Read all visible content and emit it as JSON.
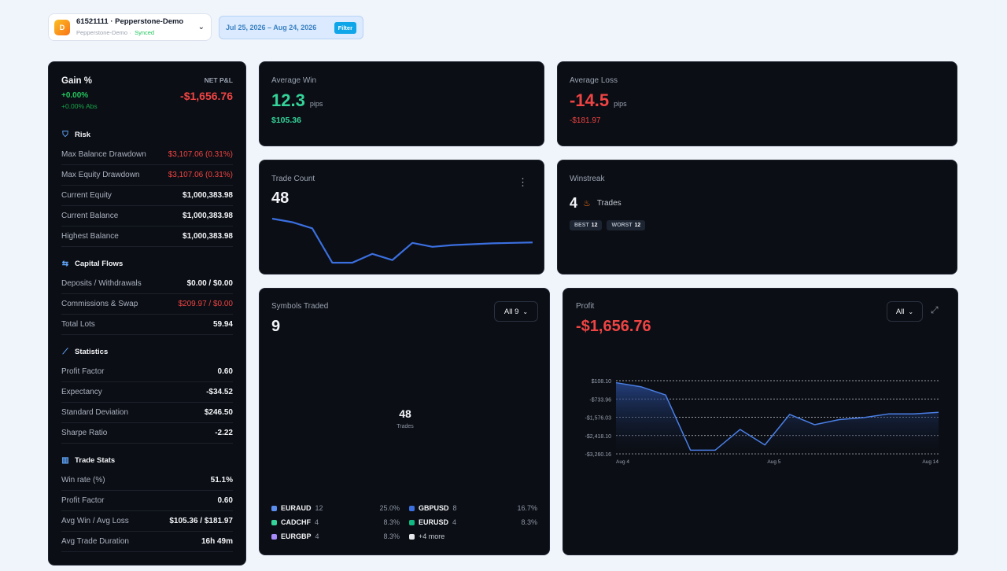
{
  "account": {
    "logo_letter": "D",
    "title": "61521111 · Pepperstone-Demo",
    "subtitle": "Pepperstone-Demo ·",
    "status": "Synced"
  },
  "daterange": {
    "text": "Jul 25, 2026 – Aug 24, 2026",
    "filter_label": "Filter"
  },
  "summary": {
    "gain_label": "Gain %",
    "gain_value": "+0.00%",
    "gain_abs": "+0.00% Abs",
    "netpnl_label": "NET P&L",
    "netpnl_value": "-$1,656.76"
  },
  "sections": {
    "risk": "Risk",
    "capital": "Capital Flows",
    "statistics": "Statistics",
    "tradestats": "Trade Stats"
  },
  "risk_rows": [
    {
      "k": "Max Balance Drawdown",
      "v": "$3,107.06 (0.31%)"
    },
    {
      "k": "Max Equity Drawdown",
      "v": "$3,107.06 (0.31%)"
    },
    {
      "k": "Current Equity",
      "v": "$1,000,383.98"
    },
    {
      "k": "Current Balance",
      "v": "$1,000,383.98"
    },
    {
      "k": "Highest Balance",
      "v": "$1,000,383.98"
    }
  ],
  "capital_rows": [
    {
      "k": "Deposits / Withdrawals",
      "v": "$0.00 / $0.00"
    },
    {
      "k": "Commissions & Swap",
      "v": "$209.97 / $0.00"
    },
    {
      "k": "Total Lots",
      "v": "59.94"
    }
  ],
  "stats_rows": [
    {
      "k": "Profit Factor",
      "v": "0.60"
    },
    {
      "k": "Expectancy",
      "v": "-$34.52"
    },
    {
      "k": "Standard Deviation",
      "v": "$246.50"
    },
    {
      "k": "Sharpe Ratio",
      "v": "-2.22"
    }
  ],
  "trade_rows": [
    {
      "k": "Win rate (%)",
      "v": "51.1%"
    },
    {
      "k": "Profit Factor",
      "v": "0.60"
    },
    {
      "k": "Avg Win / Avg Loss",
      "v": "$105.36 / $181.97"
    },
    {
      "k": "Avg Trade Duration",
      "v": "16h 49m"
    }
  ],
  "avg_win": {
    "label": "Average Win",
    "value": "12.3",
    "unit": "pips",
    "amount": "$105.36"
  },
  "avg_loss": {
    "label": "Average Loss",
    "value": "-14.5",
    "unit": "pips",
    "amount": "-$181.97"
  },
  "trade_count": {
    "label": "Trade Count",
    "value": "48",
    "menu": "⋮",
    "trend": [
      100,
      92,
      78,
      0,
      0,
      20,
      6,
      45,
      36,
      40,
      42,
      44,
      45,
      46
    ]
  },
  "winstreak": {
    "label": "Winstreak",
    "value": "4",
    "unit": "Trades",
    "best_label": "BEST",
    "best": "12",
    "worst_label": "WORST",
    "worst": "12"
  },
  "symbols": {
    "label": "Symbols Traded",
    "value": "9",
    "dropdown": "All 9",
    "center_value": "48",
    "center_label": "Trades",
    "legend": [
      {
        "name": "EURAUD",
        "count": "12",
        "pct": "25.0%",
        "color": "#5b8def"
      },
      {
        "name": "GBPUSD",
        "count": "8",
        "pct": "16.7%",
        "color": "#3b6fe0"
      },
      {
        "name": "CADCHF",
        "count": "4",
        "pct": "8.3%",
        "color": "#34d399"
      },
      {
        "name": "EURUSD",
        "count": "4",
        "pct": "8.3%",
        "color": "#10b981"
      },
      {
        "name": "EURGBP",
        "count": "4",
        "pct": "8.3%",
        "color": "#a78bfa"
      },
      {
        "name": "+4 more",
        "count": "",
        "pct": "",
        "color": "#e5e7eb"
      }
    ]
  },
  "profit": {
    "label": "Profit",
    "value": "-$1,656.76",
    "dropdown": "All"
  },
  "chart_data": {
    "type": "area",
    "y_ticks": [
      "$108.10",
      "-$733.96",
      "-$1,576.03",
      "-$2,418.10",
      "-$3,260.16"
    ],
    "ylim": [
      -3260.16,
      108.1
    ],
    "x_ticks": [
      "Aug 4",
      "Aug 5",
      "Aug 14"
    ],
    "series": [
      {
        "values": [
          15,
          -171,
          -552,
          -3092,
          -3092,
          -2138,
          -2853,
          -1446,
          -1919,
          -1683,
          -1590,
          -1420,
          -1420,
          -1350
        ]
      }
    ]
  }
}
